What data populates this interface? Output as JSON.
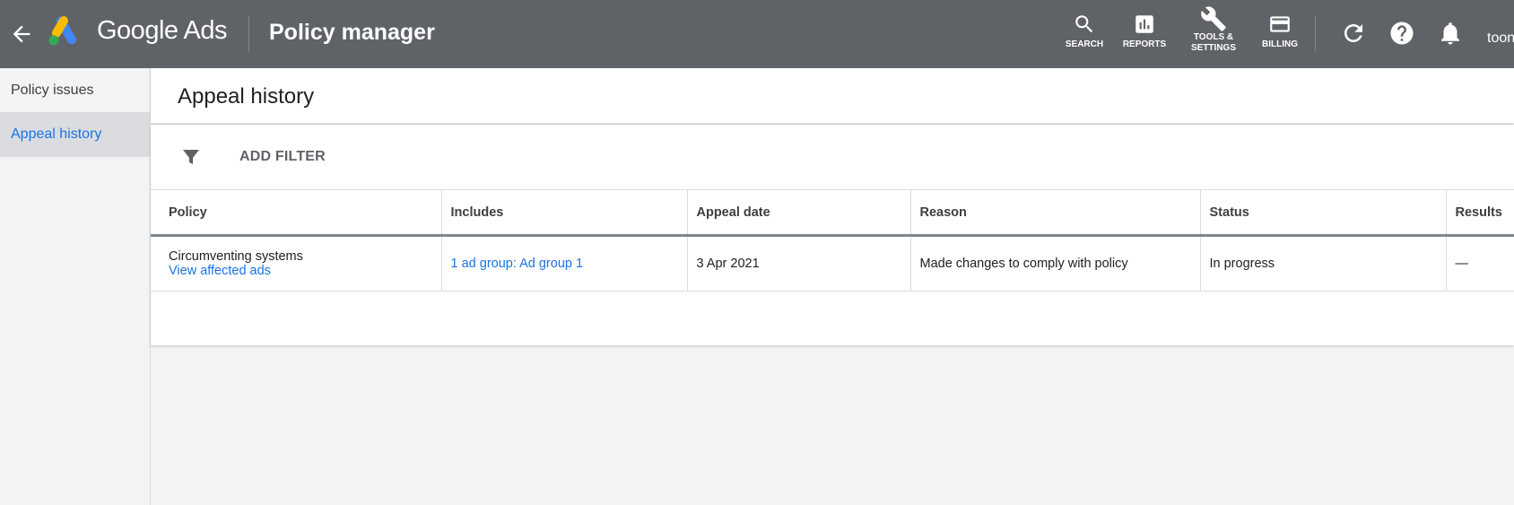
{
  "header": {
    "brand": "Google Ads",
    "app_title": "Policy manager",
    "buttons": [
      {
        "label": "SEARCH",
        "icon": "search-icon"
      },
      {
        "label": "REPORTS",
        "icon": "reports-icon"
      },
      {
        "label_line1": "TOOLS &",
        "label_line2": "SETTINGS",
        "icon": "wrench-icon"
      },
      {
        "label": "BILLING",
        "icon": "credit-card-icon"
      }
    ],
    "account": "toon",
    "colors": {
      "bar": "#5f6368"
    }
  },
  "sidebar": {
    "items": [
      {
        "label": "Policy issues",
        "active": false
      },
      {
        "label": "Appeal history",
        "active": true
      }
    ]
  },
  "page": {
    "title": "Appeal history",
    "filter_label": "ADD FILTER"
  },
  "table": {
    "columns": [
      "Policy",
      "Includes",
      "Appeal date",
      "Reason",
      "Status",
      "Results"
    ],
    "rows": [
      {
        "policy": "Circumventing systems",
        "policy_link": "View affected ads",
        "includes": "1 ad group: Ad group 1",
        "appeal_date": "3 Apr 2021",
        "reason": "Made changes to comply with policy",
        "status": "In progress",
        "results": "—"
      }
    ]
  },
  "accent_color": "#1a73e8"
}
